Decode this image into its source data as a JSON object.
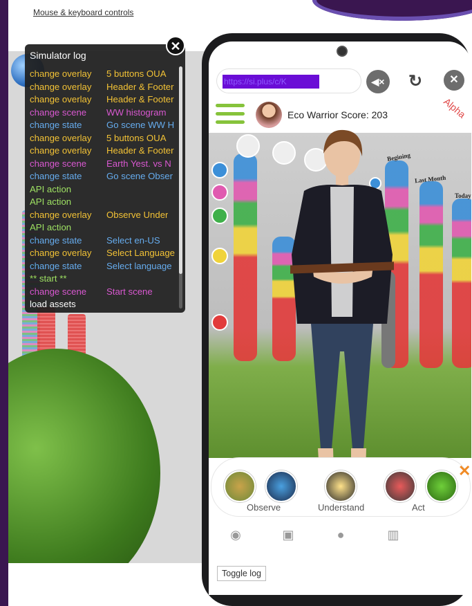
{
  "top": {
    "controls_link": "Mouse & keyboard controls"
  },
  "log": {
    "title": "Simulator log",
    "rows": [
      {
        "action": "change overlay",
        "detail": "5 buttons OUA",
        "color": "#f5c12a"
      },
      {
        "action": "change overlay",
        "detail": "Header & Footer",
        "color": "#f5c12a"
      },
      {
        "action": "change overlay",
        "detail": "Header & Footer",
        "color": "#f5c12a"
      },
      {
        "action": "change scene",
        "detail": "WW histogram",
        "color": "#d94fd0"
      },
      {
        "action": "change state",
        "detail": "Go scene WW H",
        "color": "#5ea9f0"
      },
      {
        "action": "change overlay",
        "detail": "5 buttons OUA",
        "color": "#f5c12a"
      },
      {
        "action": "change overlay",
        "detail": "Header & Footer",
        "color": "#f5c12a"
      },
      {
        "action": "change scene",
        "detail": "Earth Yest. vs N",
        "color": "#d94fd0"
      },
      {
        "action": "change state",
        "detail": "Go scene Obser",
        "color": "#5ea9f0"
      },
      {
        "action": "API action",
        "detail": "",
        "color": "#9be35b"
      },
      {
        "action": "API action",
        "detail": "",
        "color": "#9be35b"
      },
      {
        "action": "change overlay",
        "detail": "Observe Under",
        "color": "#f5c12a"
      },
      {
        "action": "API action",
        "detail": "",
        "color": "#9be35b"
      },
      {
        "action": "change state",
        "detail": "Select en-US",
        "color": "#5ea9f0"
      },
      {
        "action": "change overlay",
        "detail": "Select Language",
        "color": "#f5c12a"
      },
      {
        "action": "change state",
        "detail": "Select language",
        "color": "#5ea9f0"
      },
      {
        "action": "** start **",
        "detail": "",
        "color": "#9be35b"
      },
      {
        "action": "change scene",
        "detail": "Start scene",
        "color": "#d94fd0"
      },
      {
        "action": "load assets",
        "detail": "",
        "color": "#ffffff"
      }
    ]
  },
  "phone": {
    "url": "https://si.plus/c/K",
    "header": {
      "score_label": "Eco Warrior Score: 203",
      "badge": "Alpha"
    },
    "scene_labels": {
      "beginning": "Begining",
      "last_month": "Last Month",
      "today": "Today"
    },
    "actions": [
      {
        "label": "Observe"
      },
      {
        "label": "Understand"
      },
      {
        "label": "Act"
      }
    ],
    "toggle_log": "Toggle log"
  }
}
